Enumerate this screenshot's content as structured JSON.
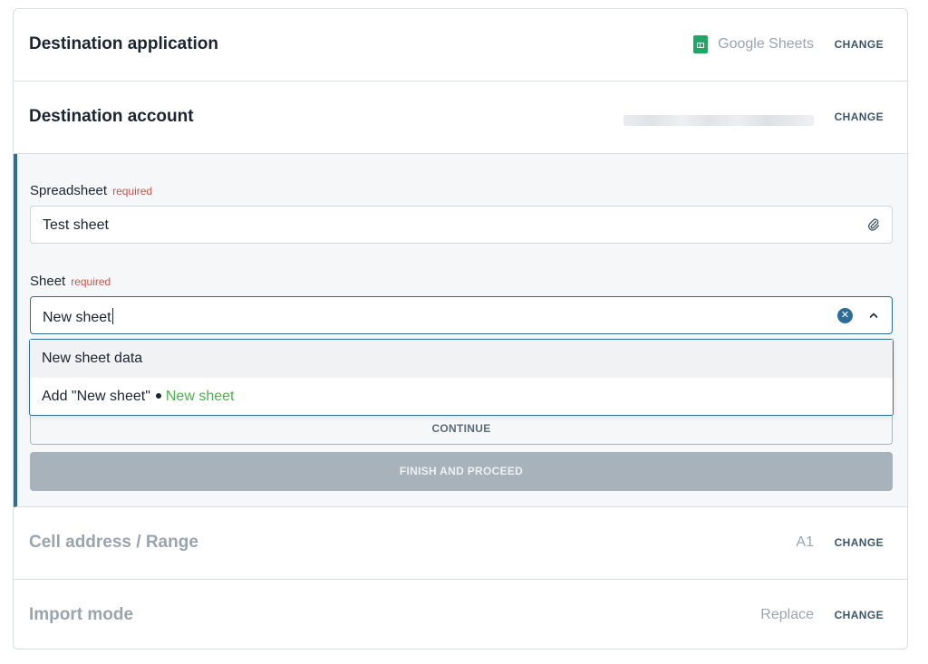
{
  "destination_application": {
    "title": "Destination application",
    "value": "Google Sheets",
    "icon": "google-sheets-icon",
    "change_label": "CHANGE"
  },
  "destination_account": {
    "title": "Destination account",
    "change_label": "CHANGE"
  },
  "spreadsheet": {
    "label": "Spreadsheet",
    "required_label": "required",
    "value": "Test sheet"
  },
  "sheet": {
    "label": "Sheet",
    "required_label": "required",
    "value": "New sheet"
  },
  "dropdown": {
    "option_existing": "New sheet data",
    "option_add_prefix": "Add \"New sheet\"",
    "option_add_tag": "New sheet"
  },
  "buttons": {
    "continue": "CONTINUE",
    "finish": "FINISH AND PROCEED"
  },
  "cell_address": {
    "title": "Cell address / Range",
    "value": "A1",
    "change_label": "CHANGE"
  },
  "import_mode": {
    "title": "Import mode",
    "value": "Replace",
    "change_label": "CHANGE"
  },
  "colors": {
    "accent": "#2c6e98",
    "required": "#c0584f",
    "sheets_green": "#23a566",
    "tag_green": "#4caf50"
  }
}
